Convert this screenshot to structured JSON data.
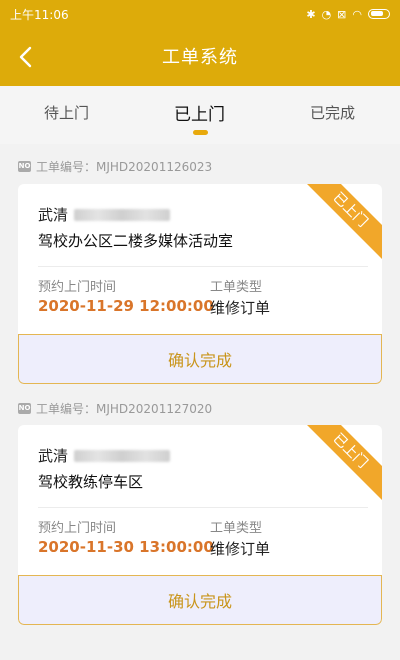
{
  "status_bar": {
    "time": "上午11:06"
  },
  "header": {
    "title": "工单系统"
  },
  "tabs": [
    {
      "label": "待上门"
    },
    {
      "label": "已上门",
      "active": true
    },
    {
      "label": "已完成"
    }
  ],
  "orders": [
    {
      "order_no_label": "工单编号：MJHD20201126023",
      "ribbon": "已上门",
      "name": "武清",
      "address": "驾校办公区二楼多媒体活动室",
      "appointment_label": "预约上门时间",
      "appointment_time": "2020-11-29 12:00:00",
      "type_label": "工单类型",
      "type": "维修订单",
      "confirm_label": "确认完成"
    },
    {
      "order_no_label": "工单编号：MJHD20201127020",
      "ribbon": "已上门",
      "name": "武清",
      "address": "驾校教练停车区",
      "appointment_label": "预约上门时间",
      "appointment_time": "2020-11-30 13:00:00",
      "type_label": "工单类型",
      "type": "维修订单",
      "confirm_label": "确认完成"
    }
  ],
  "colors": {
    "brand": "#ddab0a",
    "accent": "#e8a90c",
    "time": "#d9752a"
  }
}
